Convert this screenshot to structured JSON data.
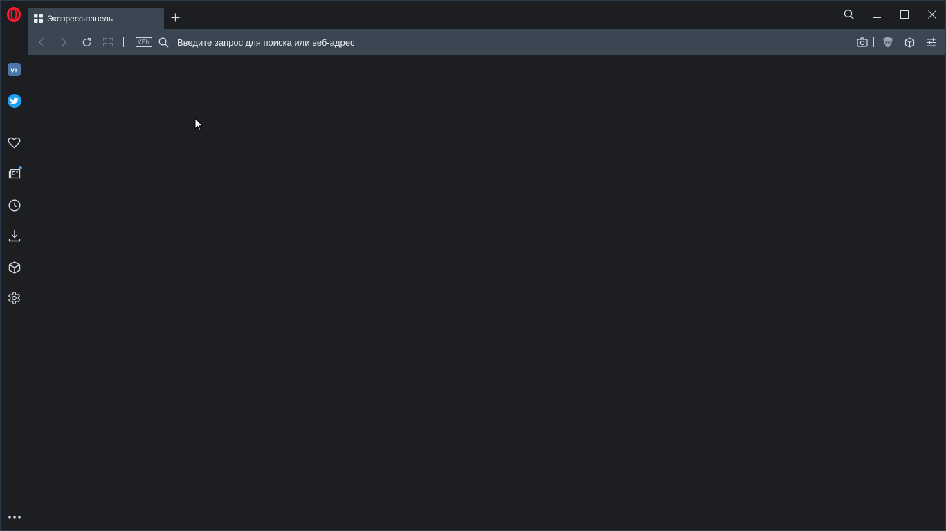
{
  "app": {
    "name": "Opera"
  },
  "tabs": [
    {
      "title": "Экспресс-панель",
      "icon": "speed-dial-icon",
      "active": true
    }
  ],
  "address_bar": {
    "placeholder": "Введите запрос для поиска или веб-адрес",
    "value": "",
    "vpn_label": "VPN"
  },
  "toolbar_icons": [
    "back-icon",
    "forward-icon",
    "reload-icon",
    "tab-grid-icon",
    "search-icon",
    "camera-icon",
    "ublock-icon",
    "cube-icon",
    "easy-setup-icon"
  ],
  "window_controls": [
    "search-tabs-icon",
    "minimize-icon",
    "maximize-icon",
    "close-icon"
  ],
  "sidebar": {
    "items": [
      "vk-icon",
      "twitter-icon",
      "heart-icon",
      "news-icon",
      "history-icon",
      "download-icon",
      "cube-icon",
      "gear-icon"
    ],
    "more": "more-icon"
  },
  "colors": {
    "accent": "#3b4653",
    "background": "#1d1e21",
    "opera_red": "#ff1b2d",
    "vk": "#4a76a8",
    "twitter": "#1da1f2",
    "notification": "#3d9ef5"
  }
}
